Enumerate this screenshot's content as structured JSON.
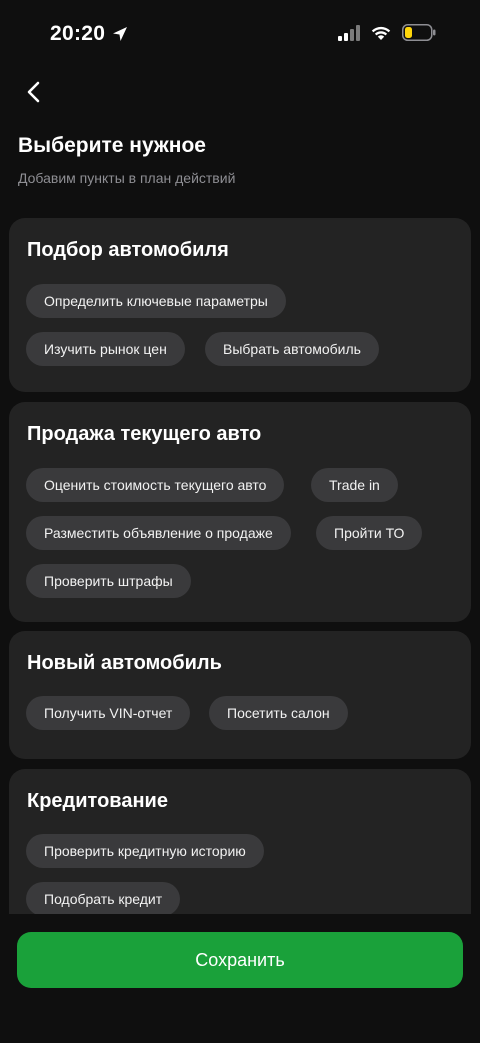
{
  "status_bar": {
    "time": "20:20",
    "location_icon": "location-arrow-icon",
    "signal_icon": "signal-icon",
    "wifi_icon": "wifi-icon",
    "battery_icon": "battery-low-icon",
    "battery_color": "#ffd60a"
  },
  "header": {
    "back_icon": "chevron-left-icon",
    "title": "Выберите нужное",
    "subtitle": "Добавим пункты в план действий"
  },
  "sections": [
    {
      "title": "Подбор автомобиля",
      "items": [
        "Определить ключевые параметры",
        "Изучить рынок цен",
        "Выбрать автомобиль"
      ]
    },
    {
      "title": "Продажа текущего авто",
      "items": [
        "Оценить стоимость текущего авто",
        "Trade in",
        "Разместить объявление о продаже",
        "Пройти ТО",
        "Проверить штрафы"
      ]
    },
    {
      "title": "Новый автомобиль",
      "items": [
        "Получить VIN-отчет",
        "Посетить салон"
      ]
    },
    {
      "title": "Кредитование",
      "items": [
        "Проверить кредитную историю",
        "Подобрать кредит"
      ]
    }
  ],
  "footer": {
    "save_label": "Сохранить",
    "accent_color": "#1aa13a"
  }
}
